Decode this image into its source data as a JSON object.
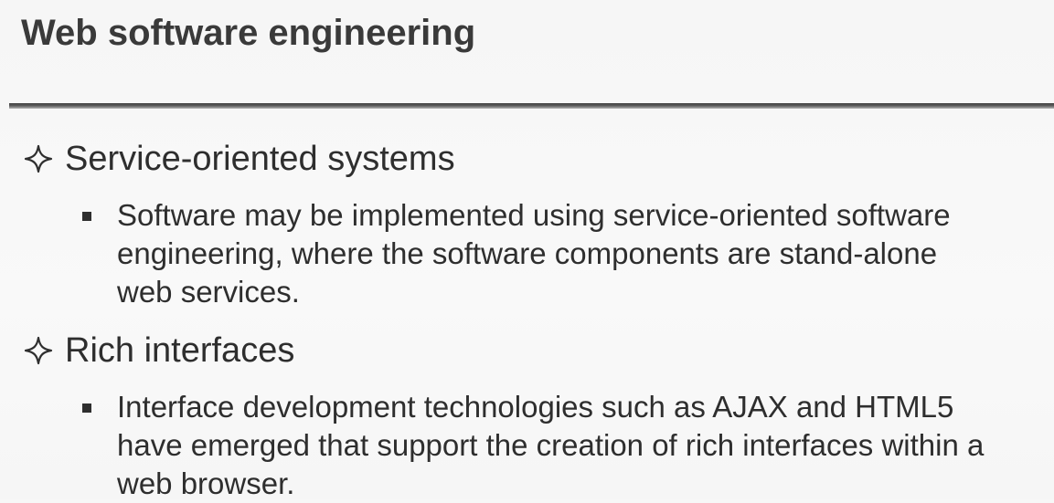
{
  "slide": {
    "title": "Web software engineering",
    "items": [
      {
        "heading": "Service-oriented systems",
        "sub_lines": [
          "Software may be implemented using service-oriented software",
          "engineering, where the software components are stand-alone",
          "web services."
        ]
      },
      {
        "heading": "Rich interfaces",
        "sub_lines": [
          "Interface development technologies such as AJAX and HTML5",
          "have emerged that support the creation of rich interfaces within a",
          "web browser."
        ]
      }
    ]
  },
  "icons": {
    "level1_bullet": "four-point-star-outline-icon",
    "level2_bullet": "square-bullet-icon"
  },
  "colors": {
    "background": "#f7f7f7",
    "text": "#2e2e2e",
    "title": "#3a3a3a",
    "rule": "#4a4a4a"
  }
}
